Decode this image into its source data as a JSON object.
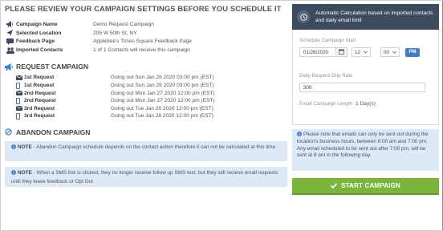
{
  "page": {
    "title": "PLEASE REVIEW YOUR CAMPAIGN SETTINGS BEFORE YOU SCHEDULE IT"
  },
  "summary": [
    {
      "icon": "megaphone-icon",
      "label": "Campaign Name",
      "value": "Demo Request Campaign"
    },
    {
      "icon": "location-pin-icon",
      "label": "Selected Location",
      "value": "205 W 50th St, NY"
    },
    {
      "icon": "comment-icon",
      "label": "Feedback Page",
      "value": "Applebee's Times Square Feedback Page"
    },
    {
      "icon": "users-icon",
      "label": "Imported Contacts",
      "value": "1 of 1 Contacts will receive this campaign"
    }
  ],
  "request_campaign": {
    "title": "REQUEST CAMPAIGN",
    "rows": [
      {
        "icon": "envelope-icon",
        "label": "1st Request",
        "value": "Going out Sun Jan 26 2020 03:00 pm (EST)"
      },
      {
        "icon": "mobile-phone-icon",
        "label": "1st Request",
        "value": "Going out Sun Jan 26 2020 03:00 pm (EST)"
      },
      {
        "icon": "envelope-icon",
        "label": "2nd Request",
        "value": "Going out Mon Jan 27 2020 12:00 pm (EST)"
      },
      {
        "icon": "mobile-phone-icon",
        "label": "2nd Request",
        "value": "Going out Mon Jan 27 2020 12:00 pm (EST)"
      },
      {
        "icon": "envelope-icon",
        "label": "3rd Request",
        "value": "Going out Tue Jan 28 2020 12:00 pm (EST)"
      },
      {
        "icon": "mobile-phone-icon",
        "label": "3rd Request",
        "value": "Going out Tue Jan 28 2020 12:00 pm (EST)"
      }
    ]
  },
  "abandon_campaign": {
    "title": "ABANDON CAMPAIGN",
    "note1_prefix": "NOTE",
    "note1_text": " - Abandon Campaign schedule depends on the contact action therefore it can not be calculated at this time",
    "note2_prefix": "NOTE",
    "note2_text": " - When a SMS link is clicked, they no longer receive follow up SMS text, but they still recieve email requests until they leave feedback or Opt Out"
  },
  "schedule_panel": {
    "header_text": "Automatic Calculation based on imported contacts and daily email limit",
    "start_label": "Schedule Campaign Start",
    "start_date": "01/26/2020",
    "hour": "12",
    "minute": "00",
    "ampm": "PM",
    "drip_label": "Daily Request Drip Rate",
    "drip_value": "300",
    "length_label": "Email Campaign Length",
    "length_value": "1 Day(s)"
  },
  "warning": {
    "line1": "Please note that emails can only be sent out during the location's business hours, between 8:00 am and 7:00 pm.",
    "line2": "Any email scheduled to be sent out after 7:00 pm, will be sent at 8 am in the following day."
  },
  "start_button": {
    "label": "START CAMPAIGN"
  },
  "colors": {
    "header_bg": "#3d4b5e",
    "note_bg": "#dde9f6",
    "accent_blue": "#3d7fd0",
    "start_green": "#7ab63c"
  }
}
